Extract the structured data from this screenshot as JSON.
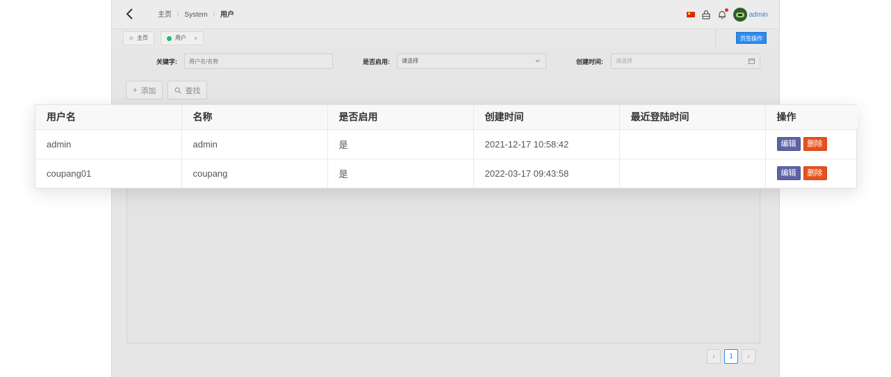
{
  "header": {
    "breadcrumb": [
      "主页",
      "System",
      "用户"
    ],
    "username": "admin"
  },
  "tabs": {
    "items": [
      {
        "label": "主页"
      },
      {
        "label": "用户",
        "close": "×"
      }
    ],
    "ops_label": "页签操作"
  },
  "filters": {
    "keyword_label": "关键字:",
    "keyword_placeholder": "用户名/名称",
    "enabled_label": "是否启用:",
    "enabled_value": "请选择",
    "created_label": "创建时间:",
    "created_placeholder": "请选择"
  },
  "actions": {
    "add_label": "添加",
    "search_label": "查找"
  },
  "table": {
    "columns": [
      "用户名",
      "名称",
      "是否启用",
      "创建时间",
      "最近登陆时间",
      "操作"
    ],
    "rows": [
      {
        "username": "admin",
        "name": "admin",
        "enabled": "是",
        "created": "2021-12-17 10:58:42",
        "last_login": "",
        "edit": "编辑",
        "delete": "删除"
      },
      {
        "username": "coupang01",
        "name": "coupang",
        "enabled": "是",
        "created": "2022-03-17 09:43:58",
        "last_login": "",
        "edit": "编辑",
        "delete": "删除"
      }
    ]
  },
  "pagination": {
    "prev": "‹",
    "current": "1",
    "next": "›"
  },
  "colors": {
    "accent": "#2d8cf0",
    "active_tab_dot": "#19be6b",
    "edit_button": "#5f63a6",
    "delete_button": "#e4521f"
  }
}
